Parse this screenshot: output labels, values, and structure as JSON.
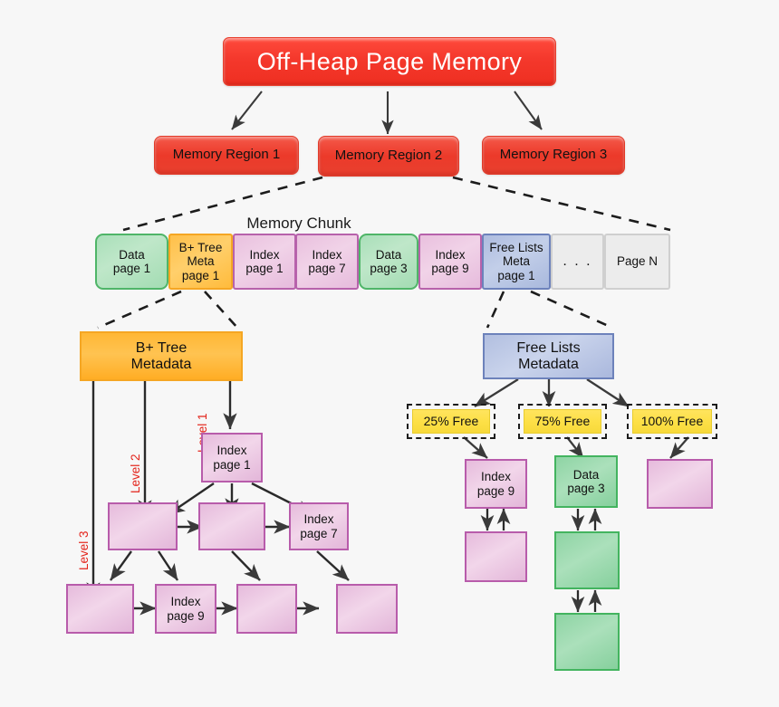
{
  "diagram": {
    "title": "Off-Heap Page Memory",
    "regions": [
      {
        "label": "Memory Region 1"
      },
      {
        "label": "Memory Region 2"
      },
      {
        "label": "Memory Region 3"
      }
    ],
    "chunk": {
      "label": "Memory Chunk",
      "cells": [
        {
          "label": "Data\npage 1",
          "kind": "green"
        },
        {
          "label": "B+ Tree\nMeta\npage 1",
          "kind": "orange"
        },
        {
          "label": "Index\npage 1",
          "kind": "pink"
        },
        {
          "label": "Index\npage 7",
          "kind": "pink"
        },
        {
          "label": "Data\npage 3",
          "kind": "green"
        },
        {
          "label": "Index\npage 9",
          "kind": "pink"
        },
        {
          "label": "Free Lists\nMeta\npage 1",
          "kind": "blue"
        },
        {
          "label": ". . .",
          "kind": "gray"
        },
        {
          "label": "Page N",
          "kind": "gray"
        }
      ]
    },
    "btree": {
      "head": "B+ Tree\nMetadata",
      "levels": [
        {
          "label": "Level 1"
        },
        {
          "label": "Level 2"
        },
        {
          "label": "Level 3"
        }
      ],
      "level1": [
        {
          "label": "Index\npage 1"
        }
      ],
      "level2": [
        {
          "label": ""
        },
        {
          "label": ""
        },
        {
          "label": "Index\npage 7"
        }
      ],
      "level3": [
        {
          "label": ""
        },
        {
          "label": "Index\npage 9"
        },
        {
          "label": ""
        },
        {
          "label": ""
        }
      ]
    },
    "freelists": {
      "head": "Free Lists\nMetadata",
      "buckets": [
        {
          "label": "25% Free"
        },
        {
          "label": "75% Free"
        },
        {
          "label": "100% Free"
        }
      ],
      "chain_25": [
        {
          "label": "Index\npage 9",
          "kind": "pink"
        },
        {
          "label": "",
          "kind": "pink"
        }
      ],
      "chain_75": [
        {
          "label": "Data\npage 3",
          "kind": "green"
        },
        {
          "label": "",
          "kind": "green"
        },
        {
          "label": "",
          "kind": "green"
        }
      ],
      "chain_100": [
        {
          "label": "",
          "kind": "pink"
        }
      ]
    },
    "colors": {
      "red": "#ef2f21",
      "orange": "#ffb735",
      "pink": "#e6bbdc",
      "pink_border": "#b85cab",
      "green": "#8ed4a4",
      "green_border": "#43b45f",
      "blue": "#b2bfe0",
      "blue_border": "#6d82bb",
      "yellow": "#fde047",
      "level_label_red": "#e3241b",
      "arrow": "#3a3a3a",
      "background": "#f7f7f7"
    }
  }
}
